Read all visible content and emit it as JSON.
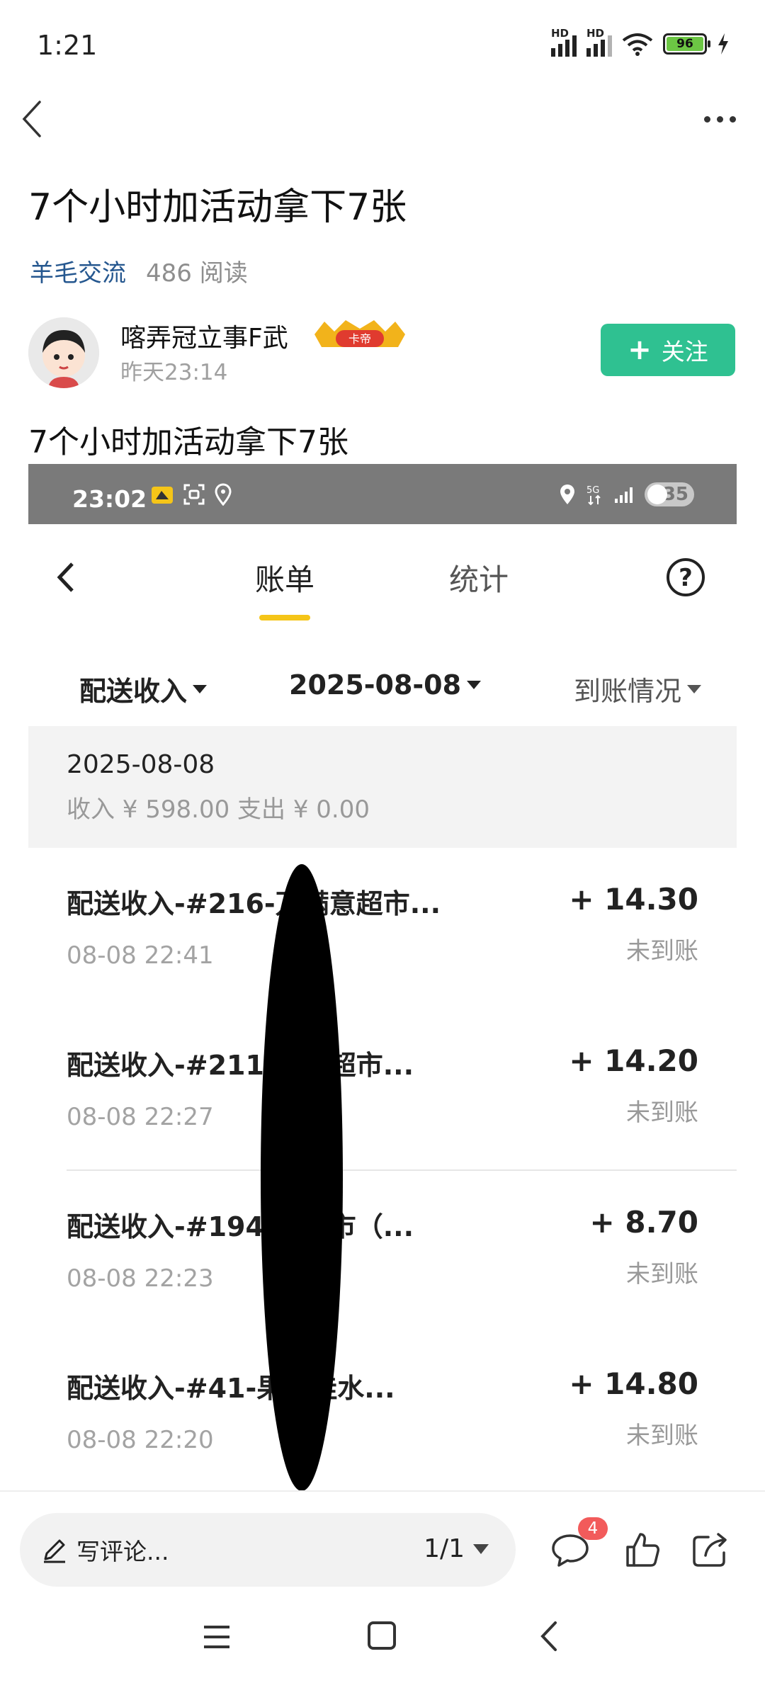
{
  "status_bar": {
    "time": "1:21",
    "battery": "96",
    "network_label": "HD"
  },
  "post": {
    "title": "7个小时加活动拿下7张",
    "category": "羊毛交流",
    "read_count": "486 阅读",
    "author_name": "喀弄冠立事F武",
    "author_badge": "卡帝",
    "post_time": "昨天23:14",
    "follow_label": "关注",
    "body": "7个小时加活动拿下7张"
  },
  "screenshot": {
    "status_time": "23:02",
    "status_battery": "35",
    "tabs": [
      "账单",
      "统计"
    ],
    "help_label": "?",
    "filters": [
      "配送收入",
      "2025-08-08",
      "到账情况"
    ],
    "summary": {
      "date": "2025-08-08",
      "line": "收入 ¥ 598.00 支出 ¥ 0.00"
    },
    "records": [
      {
        "title": "配送收入-#216-万满意超市...",
        "time": "08-08 22:41",
        "amount": "+ 14.30",
        "status": "未到账"
      },
      {
        "title": "配送收入-#211-满意超市...",
        "time": "08-08 22:27",
        "amount": "+ 14.20",
        "status": "未到账"
      },
      {
        "title": "配送收入-#194-佳超市（...",
        "time": "08-08 22:23",
        "amount": "+ 8.70",
        "status": "未到账"
      },
      {
        "title": "配送收入-#41-果美佳水...",
        "time": "08-08 22:20",
        "amount": "+ 14.80",
        "status": "未到账"
      }
    ]
  },
  "comment_bar": {
    "placeholder": "写评论...",
    "page_indicator": "1/1",
    "comment_count": "4"
  },
  "colors": {
    "accent": "#2fc191",
    "link": "#25578f",
    "tab_underline": "#f5c518",
    "badge": "#f25b5b"
  }
}
